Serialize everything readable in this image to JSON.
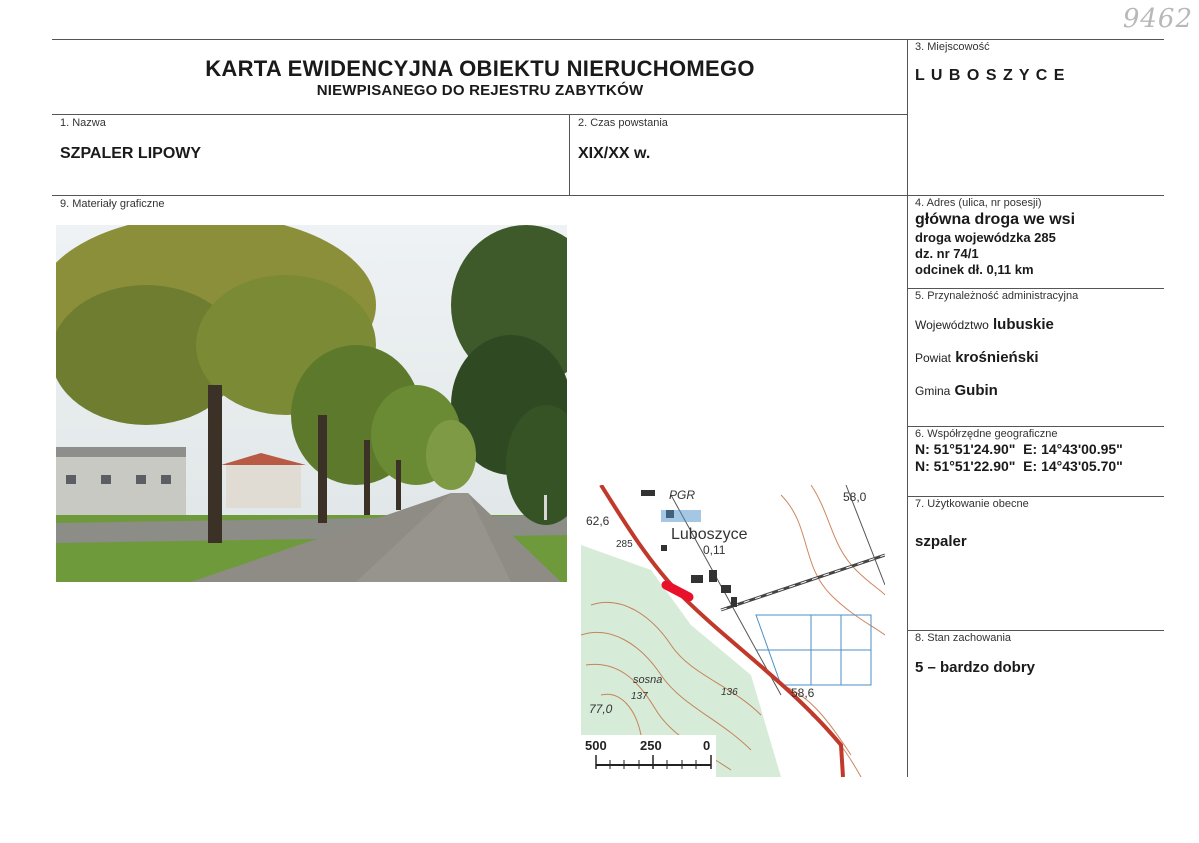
{
  "header": {
    "title": "KARTA EWIDENCYJNA OBIEKTU NIERUCHOMEGO",
    "subtitle": "NIEWPISANEGO DO REJESTRU ZABYTKÓW",
    "handwritten_number": "9462"
  },
  "fields": {
    "nazwa": {
      "label": "1. Nazwa",
      "value": "SZPALER LIPOWY"
    },
    "czas": {
      "label": "2. Czas powstania",
      "value": "XIX/XX w."
    },
    "miejscowosc": {
      "label": "3. Miejscowość",
      "value": "L U B O S Z Y C E"
    },
    "adres": {
      "label": "4. Adres (ulica, nr posesji)",
      "line1": "główna droga we wsi",
      "line2": "droga wojewódzka 285",
      "line3": "dz. nr 74/1",
      "line4": "odcinek dł. 0,11 km"
    },
    "przynaleznosc": {
      "label": "5. Przynależność administracyjna",
      "woj_label": "Województwo",
      "woj_value": "lubuskie",
      "powiat_label": "Powiat",
      "powiat_value": "krośnieński",
      "gmina_label": "Gmina",
      "gmina_value": "Gubin"
    },
    "wspolrzedne": {
      "label": "6. Współrzędne geograficzne",
      "line1": "N: 51°51'24.90\"  E: 14°43'00.95\"",
      "line2": "N: 51°51'22.90\"  E: 14°43'05.70\""
    },
    "uzytkowanie": {
      "label": "7. Użytkowanie obecne",
      "value": "szpaler"
    },
    "stan": {
      "label": "8. Stan zachowania",
      "value": "5 – bardzo dobry"
    },
    "materialy": {
      "label": "9. Materiały graficzne"
    }
  },
  "map": {
    "place": "Luboszyce",
    "segment": "0,11",
    "pgr": "PGR",
    "road": "285",
    "heights": [
      "58,0",
      "62,6",
      "58,6",
      "77,0",
      "137",
      "136"
    ],
    "forest": "sosna",
    "scale": [
      "500",
      "250",
      "0"
    ],
    "colors": {
      "road": "#c0392b",
      "highlight": "#e8102a",
      "forest": "#d6ecd9",
      "contour": "#c26a3a"
    }
  }
}
